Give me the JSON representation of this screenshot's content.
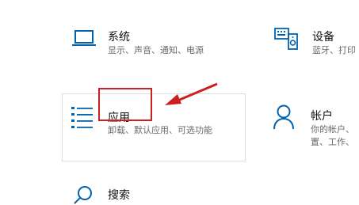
{
  "tiles": {
    "system": {
      "title": "系统",
      "desc": "显示、声音、通知、电源",
      "icon": "laptop-icon"
    },
    "devices": {
      "title": "设备",
      "desc": "蓝牙、打印",
      "icon": "keyboard-speaker-icon"
    },
    "apps": {
      "title": "应用",
      "desc": "卸载、默认应用、可选功能",
      "icon": "apps-list-icon"
    },
    "accounts": {
      "title": "帐户",
      "desc_line1": "你的帐户、",
      "desc_line2": "置、工作、",
      "icon": "person-icon"
    },
    "search": {
      "title": "搜索",
      "icon": "search-icon"
    }
  },
  "colors": {
    "accent": "#0063b1",
    "annotation": "#cc1f1f",
    "hover_border": "#dddddd"
  }
}
